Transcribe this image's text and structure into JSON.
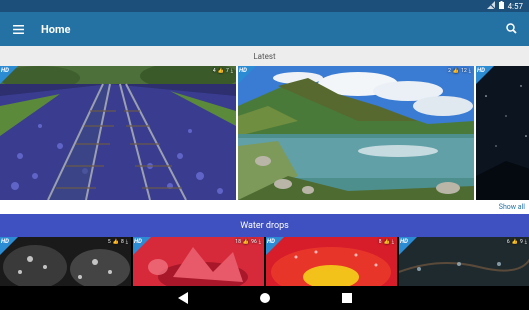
{
  "status_bar": {
    "time": "4:57"
  },
  "app_bar": {
    "title": "Home"
  },
  "latest": {
    "header": "Latest",
    "items": [
      {
        "rating": "4",
        "downloads": "7",
        "hd": "HD"
      },
      {
        "rating": "2",
        "downloads": "12",
        "hd": "HD"
      },
      {
        "rating": "",
        "downloads": "",
        "hd": "HD"
      }
    ],
    "show_all": "Show all"
  },
  "category": {
    "title": "Water drops",
    "items": [
      {
        "rating": "5",
        "downloads": "8",
        "hd": "HD"
      },
      {
        "rating": "18",
        "downloads": "96",
        "hd": "HD"
      },
      {
        "rating": "8",
        "downloads": "",
        "hd": "HD"
      },
      {
        "rating": "6",
        "downloads": "9",
        "hd": "HD"
      }
    ]
  },
  "colors": {
    "status_bar": "#1c4f79",
    "app_bar": "#2471a3",
    "category_bar": "#3f51c1",
    "hd_badge": "#2b8bd3"
  }
}
